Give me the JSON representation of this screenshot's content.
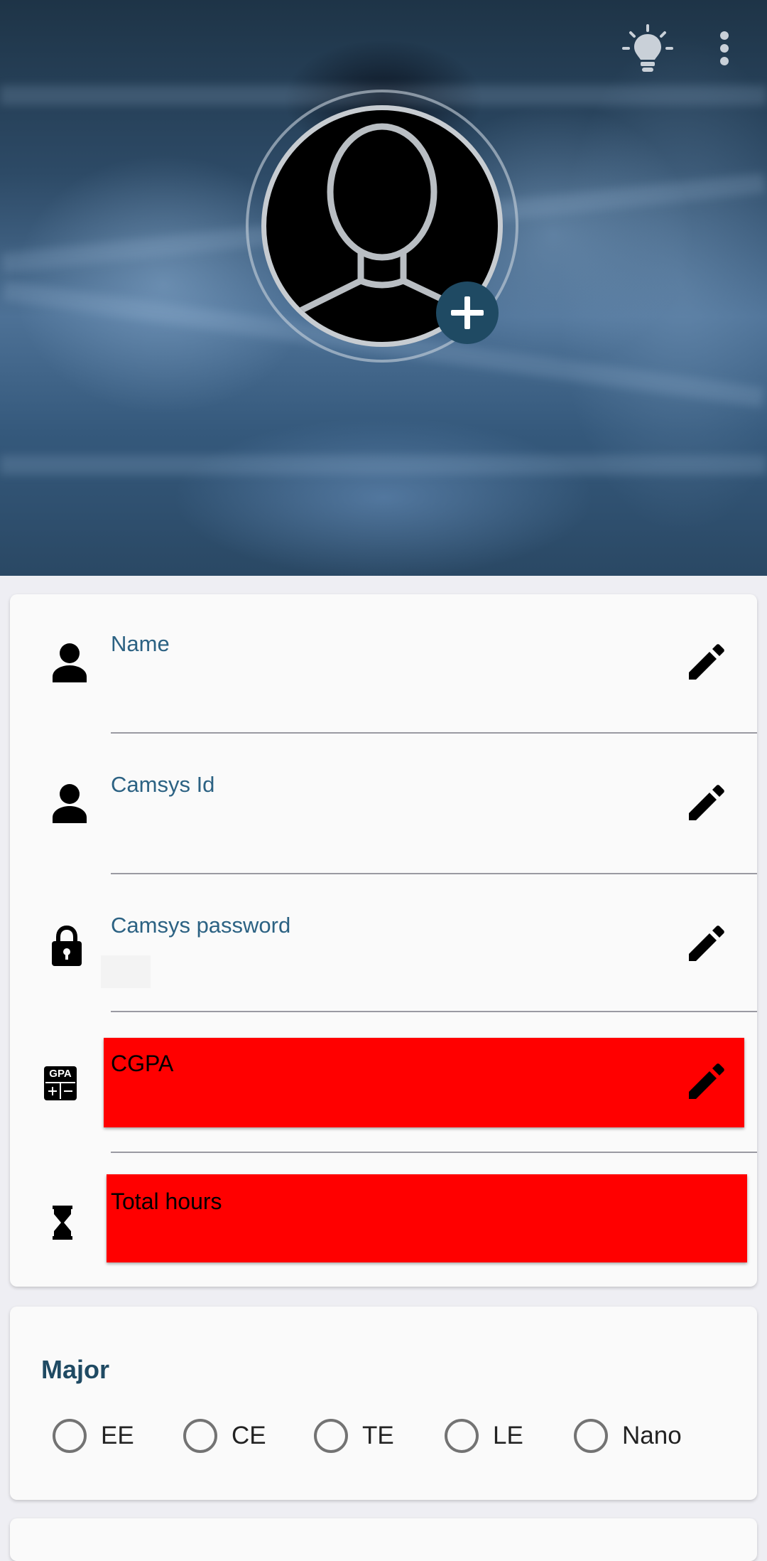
{
  "header": {
    "icons": [
      "lightbulb-icon",
      "more-vert-icon",
      "avatar-placeholder-icon",
      "add-icon"
    ]
  },
  "profile_fields": [
    {
      "label": "Name",
      "icon": "person-icon"
    },
    {
      "label": "Camsys Id",
      "icon": "person-icon"
    },
    {
      "label": "Camsys password",
      "icon": "lock-icon"
    },
    {
      "label": "CGPA",
      "icon": "gpa-calculator-icon",
      "badge_text": "GPA"
    },
    {
      "label": "Total hours",
      "icon": "hourglass-icon"
    }
  ],
  "major": {
    "title": "Major",
    "options": [
      "EE",
      "CE",
      "TE",
      "LE",
      "Nano"
    ]
  },
  "colors": {
    "accent": "#1f4a63",
    "label": "#2c6283",
    "highlight": "#ff0000",
    "background": "#eeeef3",
    "card": "#fafafa"
  }
}
